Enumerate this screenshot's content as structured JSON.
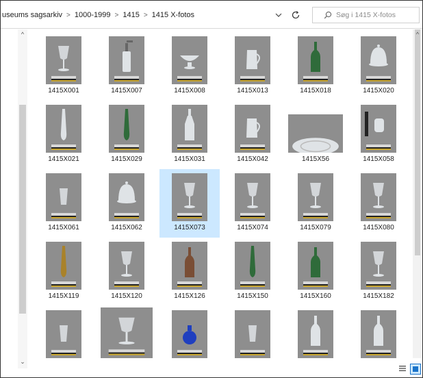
{
  "breadcrumb": [
    "useums sagsarkiv",
    "1000-1999",
    "1415",
    "1415 X-fotos"
  ],
  "search": {
    "placeholder": "Søg i 1415 X-fotos"
  },
  "colors": {
    "selection": "#cce8ff",
    "selection_border": "#1a73c9",
    "photo_bg": "#8e8e8e"
  },
  "icons": [
    "chevron-down-icon",
    "refresh-icon",
    "search-icon",
    "details-view-icon",
    "large-icons-view-icon"
  ],
  "files": [
    {
      "name": "1415X001",
      "obj": "goblet",
      "tint": "clear",
      "layout": "tall"
    },
    {
      "name": "1415X007",
      "obj": "siphon",
      "tint": "clear",
      "layout": "tall"
    },
    {
      "name": "1415X008",
      "obj": "bowl",
      "tint": "clear",
      "layout": "tall"
    },
    {
      "name": "1415X013",
      "obj": "pitcher",
      "tint": "clear",
      "layout": "tall"
    },
    {
      "name": "1415X018",
      "obj": "bottle",
      "tint": "green",
      "layout": "tall"
    },
    {
      "name": "1415X020",
      "obj": "dome",
      "tint": "clear",
      "layout": "tall"
    },
    {
      "name": "1415X021",
      "obj": "vase",
      "tint": "clear",
      "layout": "tall"
    },
    {
      "name": "1415X029",
      "obj": "vase",
      "tint": "green",
      "layout": "tall"
    },
    {
      "name": "1415X031",
      "obj": "decanter",
      "tint": "clear",
      "layout": "tall"
    },
    {
      "name": "1415X042",
      "obj": "pitcher",
      "tint": "clear",
      "layout": "tall"
    },
    {
      "name": "1415X56",
      "obj": "plate",
      "tint": "clear",
      "layout": "wide"
    },
    {
      "name": "1415X058",
      "obj": "cup",
      "tint": "clear",
      "layout": "tall"
    },
    {
      "name": "1415X061",
      "obj": "glass",
      "tint": "clear",
      "layout": "tall"
    },
    {
      "name": "1415X062",
      "obj": "dome",
      "tint": "clear",
      "layout": "tall"
    },
    {
      "name": "1415X073",
      "obj": "goblet",
      "tint": "clear",
      "layout": "tall",
      "selected": true
    },
    {
      "name": "1415X074",
      "obj": "goblet",
      "tint": "clear",
      "layout": "tall"
    },
    {
      "name": "1415X079",
      "obj": "goblet",
      "tint": "clear",
      "layout": "tall"
    },
    {
      "name": "1415X080",
      "obj": "goblet",
      "tint": "clear",
      "layout": "tall"
    },
    {
      "name": "1415X119",
      "obj": "vase",
      "tint": "amber",
      "layout": "tall"
    },
    {
      "name": "1415X120",
      "obj": "goblet",
      "tint": "clear",
      "layout": "tall"
    },
    {
      "name": "1415X126",
      "obj": "bottle",
      "tint": "brown",
      "layout": "tall"
    },
    {
      "name": "1415X150",
      "obj": "vase",
      "tint": "green",
      "layout": "tall"
    },
    {
      "name": "1415X160",
      "obj": "bottle",
      "tint": "green",
      "layout": "tall"
    },
    {
      "name": "1415X182",
      "obj": "goblet",
      "tint": "clear",
      "layout": "tall"
    },
    {
      "name": "",
      "obj": "glass",
      "tint": "clear",
      "layout": "tall"
    },
    {
      "name": "",
      "obj": "goblet",
      "tint": "clear",
      "layout": "big"
    },
    {
      "name": "",
      "obj": "flask",
      "tint": "blue",
      "layout": "tall"
    },
    {
      "name": "",
      "obj": "glass",
      "tint": "clear",
      "layout": "tall"
    },
    {
      "name": "",
      "obj": "bottle",
      "tint": "clear",
      "layout": "tall"
    },
    {
      "name": "",
      "obj": "bottle",
      "tint": "clear",
      "layout": "tall"
    }
  ]
}
